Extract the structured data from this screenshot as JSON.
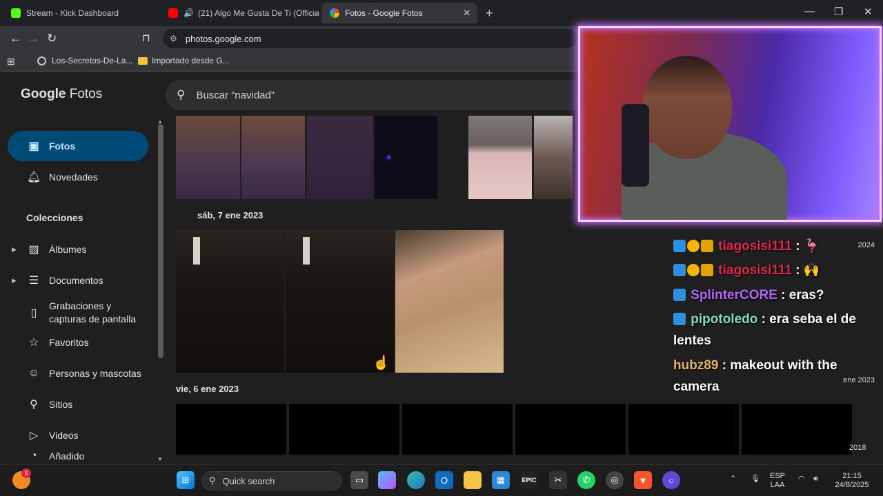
{
  "browser": {
    "tabs": [
      {
        "label": "Stream - Kick Dashboard",
        "active": false
      },
      {
        "label": "(21) Algo Me Gusta De Ti (Official",
        "active": false
      },
      {
        "label": "Fotos - Google Fotos",
        "active": true
      }
    ],
    "new_tab": "+",
    "url": "photos.google.com",
    "bookmarks": [
      "Los-Secretos-De-La...",
      "Importado desde G..."
    ]
  },
  "app": {
    "logo_google": "Google",
    "logo_fotos": "Fotos",
    "search_placeholder": "Buscar “navidad”"
  },
  "sidebar": {
    "items": [
      {
        "label": "Fotos",
        "icon": "photo-icon",
        "active": true
      },
      {
        "label": "Novedades",
        "icon": "bell-icon"
      }
    ],
    "collections_heading": "Colecciones",
    "collections": [
      {
        "label": "Álbumes",
        "icon": "album-icon",
        "expandable": true
      },
      {
        "label": "Documentos",
        "icon": "document-icon",
        "expandable": true
      },
      {
        "label": "Grabaciones y capturas de pantalla",
        "icon": "phone-icon"
      },
      {
        "label": "Favoritos",
        "icon": "star-icon"
      },
      {
        "label": "Personas y mascotas",
        "icon": "face-icon"
      },
      {
        "label": "Sitios",
        "icon": "location-icon"
      },
      {
        "label": "Videos",
        "icon": "play-icon"
      },
      {
        "label": "Añadido",
        "icon": "added-icon"
      }
    ]
  },
  "gallery": {
    "dates": [
      "sáb, 7 ene 2023",
      "vie, 6 ene 2023"
    ]
  },
  "chat": {
    "messages": [
      {
        "user": "tiagosisi111",
        "text": ": 🦩",
        "user_color": "#e0284f",
        "year": "2024"
      },
      {
        "user": "tiagosisi111",
        "text": ": 🙌",
        "user_color": "#e0284f"
      },
      {
        "user": "SplinterCORE",
        "text": ": eras?",
        "user_color": "#b266ff"
      },
      {
        "user": "pipotoledo",
        "text": ": era seba el de lentes",
        "user_color": "#7fe0b5"
      },
      {
        "user": "hubz89",
        "text": ": makeout with the camera",
        "user_color": "#e8b16a"
      }
    ],
    "year_labels": [
      "ene 2023",
      "2018"
    ]
  },
  "taskbar": {
    "notification_count": "6",
    "search_placeholder": "Quick search",
    "language": "ESP",
    "layout": "LAA",
    "time": "21:15",
    "date": "24/8/2025"
  },
  "colors": {
    "sidebar_active_bg": "#004a77",
    "accent": "#c2e7ff",
    "cam_border": "#c46bff"
  }
}
